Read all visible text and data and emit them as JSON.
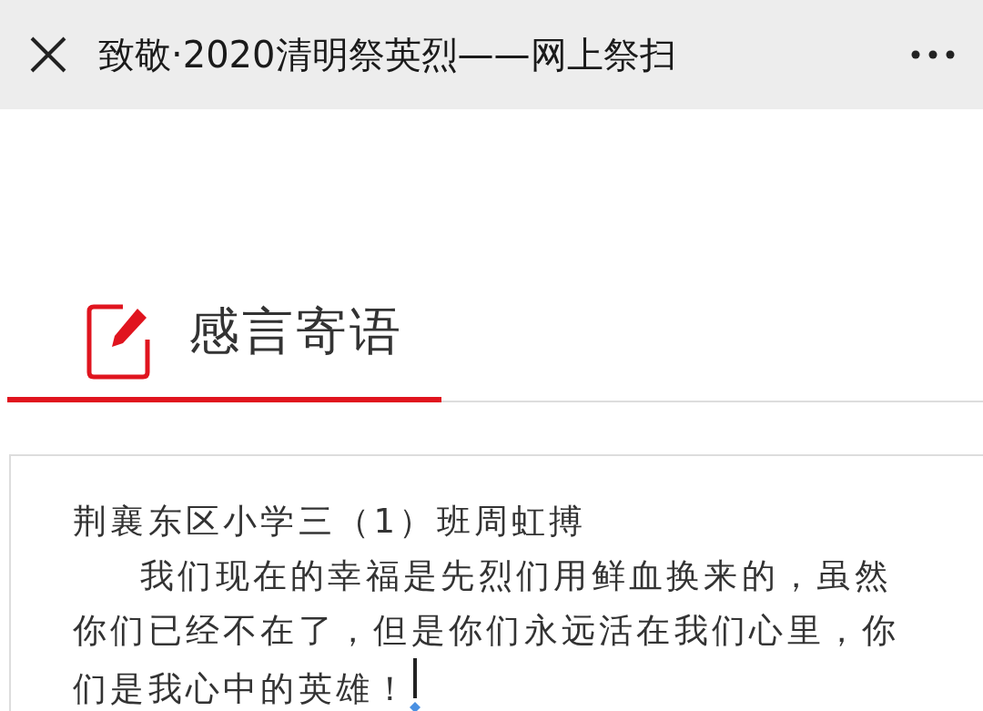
{
  "header": {
    "title": "致敬·2020清明祭英烈——网上祭扫"
  },
  "section": {
    "title": "感言寄语"
  },
  "message_field": {
    "author": "荆襄东区小学三（1）班周虹搏",
    "body": "我们现在的幸福是先烈们用鲜血换来的，虽然你们已经不在了，但是你们永远活在我们心里，你们是我心中的英雄！",
    "focused": true
  }
}
